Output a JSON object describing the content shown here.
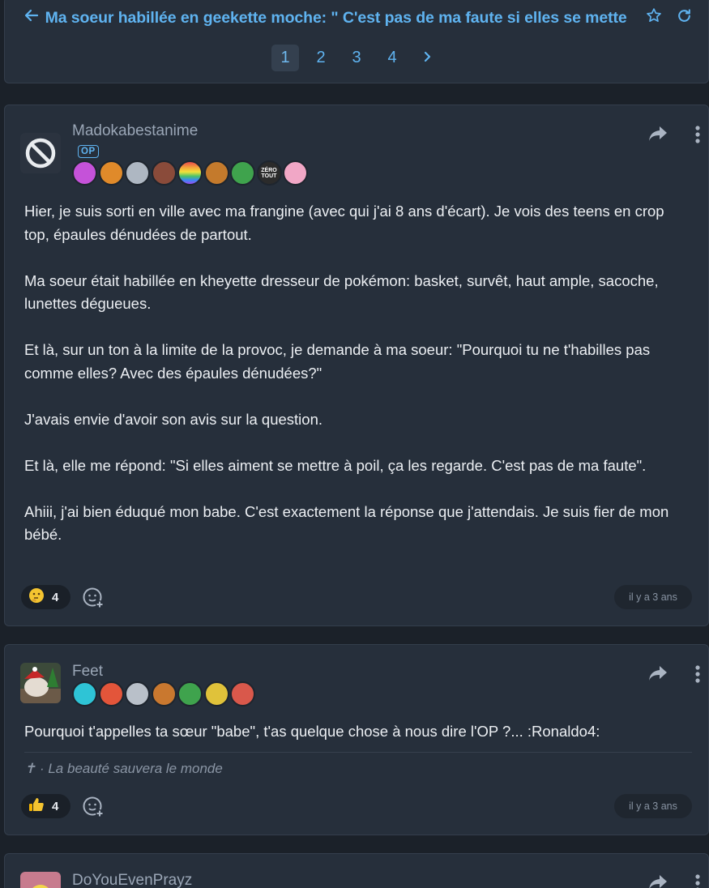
{
  "topic": {
    "back_icon": "arrow-left-icon",
    "title": "Ma soeur habillée en geekette moche: \" C'est pas de ma faute si elles se mette",
    "favorite_icon": "star-icon",
    "refresh_icon": "refresh-icon"
  },
  "pagination": {
    "pages": [
      "1",
      "2",
      "3",
      "4"
    ],
    "current": "1",
    "next_label": "›"
  },
  "posts": [
    {
      "author": "Madokabestanime",
      "op_label": "OP",
      "avatar": "banned-icon",
      "paragraphs": [
        "Hier, je suis sorti en ville avec ma frangine (avec qui j'ai 8 ans d'écart). Je vois des teens en crop top, épaules dénudées de partout.",
        "Ma soeur était habillée en kheyette dresseur de pokémon: basket, survêt, haut ample, sacoche, lunettes dégueues.",
        "Et là, sur un ton à la limite de la provoc, je demande à ma soeur: \"Pourquoi tu ne t'habilles pas comme elles? Avec des épaules dénudées?\"",
        "J'avais envie d'avoir son avis sur la question.",
        "Et là, elle me répond: \"Si elles aiment se mettre à poil, ça les regarde. C'est pas de ma faute\".",
        "Ahiii, j'ai bien éduqué mon babe. C'est exactement la réponse que j'attendais. Je suis fier de mon bébé."
      ],
      "reaction_icon": "thinking-face-icon",
      "reaction_count": "4",
      "time": "il y a 3 ans",
      "badge_colors": [
        "#c552d9",
        "#e08a2a",
        "#aeb7c2",
        "#8a4b3a",
        "#e04f8f",
        "#c47a2c",
        "#3fa34d",
        "#2b2b2b",
        "#f1a7c6"
      ],
      "badge_zero_text": "ZÉRO TOUT"
    },
    {
      "author": "Feet",
      "paragraphs": [
        "Pourquoi t'appelles ta sœur \"babe\", t'as quelque chose à nous dire l'OP ?... :Ronaldo4:"
      ],
      "signature": "✝ · La beauté sauvera le monde",
      "reaction_icon": "thumbs-up-icon",
      "reaction_count": "4",
      "time": "il y a 3 ans",
      "badge_colors": [
        "#2ec4d6",
        "#e3553a",
        "#b9c0c9",
        "#c9782f",
        "#3fa34d",
        "#e0c23a",
        "#d9584b"
      ]
    },
    {
      "author": "DoYouEvenPrayz"
    }
  ],
  "colors": {
    "accent": "#5fb3f0",
    "card": "#262f3b",
    "background": "#1b2129"
  }
}
